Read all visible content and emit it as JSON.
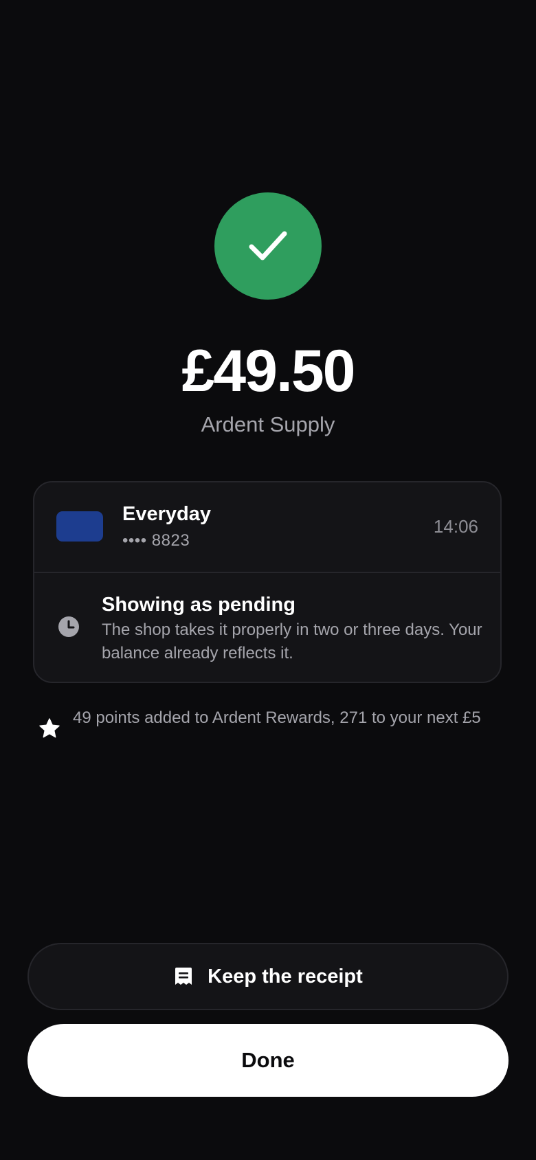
{
  "theme": {
    "background": "#0b0b0d",
    "success": "#2f9e5e",
    "card_swatch": "#1d3d8f",
    "panel": "#141417",
    "muted_text": "#a5a5ac"
  },
  "payment": {
    "status_icon": "checkmark-icon",
    "amount": "£49.50",
    "merchant": "Ardent Supply"
  },
  "account": {
    "name": "Everyday",
    "number": "•••• 8823",
    "time": "14:06"
  },
  "pending": {
    "icon": "clock-icon",
    "title": "Showing as pending",
    "body": "The shop takes it properly in two or three days. Your balance already reflects it."
  },
  "rewards": {
    "icon": "star-icon",
    "text": "49 points added to Ardent Rewards, 271 to your next £5"
  },
  "actions": {
    "receipt_icon": "receipt-icon",
    "receipt_label": "Keep the receipt",
    "done_label": "Done"
  }
}
